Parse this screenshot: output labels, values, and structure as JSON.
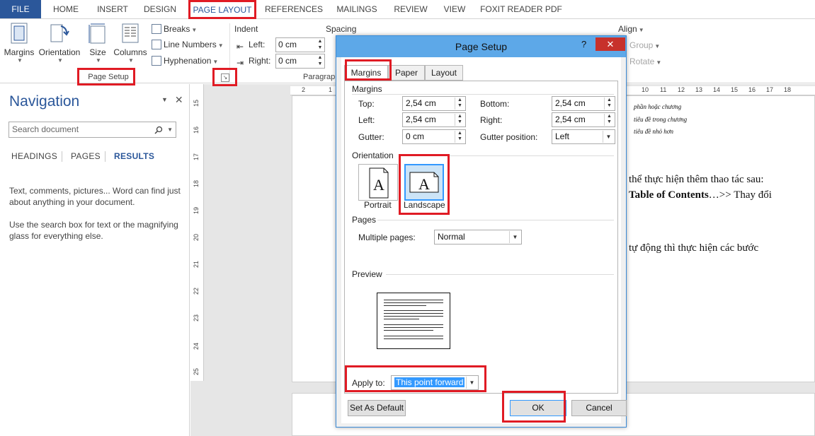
{
  "tabs": [
    "FILE",
    "HOME",
    "INSERT",
    "DESIGN",
    "PAGE LAYOUT",
    "REFERENCES",
    "MAILINGS",
    "REVIEW",
    "VIEW",
    "FOXIT READER PDF"
  ],
  "ribbon": {
    "margins": "Margins",
    "orientation": "Orientation",
    "size": "Size",
    "columns": "Columns",
    "breaks": "Breaks",
    "line_numbers": "Line Numbers",
    "hyphenation": "Hyphenation",
    "page_setup_label": "Page Setup",
    "indent": "Indent",
    "indent_left_label": "Left:",
    "indent_left_value": "0 cm",
    "indent_right_label": "Right:",
    "indent_right_value": "0 cm",
    "spacing": "Spacing",
    "paragraph_label": "Paragrap",
    "align": "Align",
    "group": "Group",
    "rotate": "Rotate"
  },
  "navigation": {
    "title": "Navigation",
    "search_placeholder": "Search document",
    "tabs": [
      "HEADINGS",
      "PAGES",
      "RESULTS"
    ],
    "text1": "Text, comments, pictures... Word can find just about anything in your document.",
    "text2": "Use the search box for text or the magnifying glass for everything else."
  },
  "ruler": {
    "horizontal": [
      "2",
      "1"
    ],
    "horizontal_right": [
      "10",
      "11",
      "12",
      "13",
      "14",
      "15",
      "16",
      "17",
      "18"
    ],
    "vertical": [
      "15",
      "16",
      "17",
      "18",
      "19",
      "20",
      "21",
      "22",
      "23",
      "24",
      "25"
    ]
  },
  "document": {
    "toc1": "phần hoặc chương",
    "toc2": "tiêu đề trong chương",
    "toc3": "tiêu đề nhỏ hơn",
    "line1": "thể thực hiện thêm thao tác sau:",
    "line2_bold": "Table of Contents",
    "line2_rest": "…>> Thay đổi",
    "line3": "tự động thì thực hiện các bước"
  },
  "dialog": {
    "title": "Page Setup",
    "help": "?",
    "close": "✕",
    "tabs": [
      "Margins",
      "Paper",
      "Layout"
    ],
    "margins_section": "Margins",
    "top_label": "Top:",
    "top_value": "2,54 cm",
    "bottom_label": "Bottom:",
    "bottom_value": "2,54 cm",
    "left_label": "Left:",
    "left_value": "2,54 cm",
    "right_label": "Right:",
    "right_value": "2,54 cm",
    "gutter_label": "Gutter:",
    "gutter_value": "0 cm",
    "gutter_pos_label": "Gutter position:",
    "gutter_pos_value": "Left",
    "orientation_section": "Orientation",
    "portrait": "Portrait",
    "landscape": "Landscape",
    "pages_section": "Pages",
    "multiple_pages_label": "Multiple pages:",
    "multiple_pages_value": "Normal",
    "preview_section": "Preview",
    "apply_to_label": "Apply to:",
    "apply_to_value": "This point forward",
    "set_default": "Set As Default",
    "ok": "OK",
    "cancel": "Cancel"
  },
  "colors": {
    "accent": "#2b579a",
    "highlight": "#e01b24",
    "selection": "#3399ff",
    "dialog_title": "#5da8e8"
  }
}
